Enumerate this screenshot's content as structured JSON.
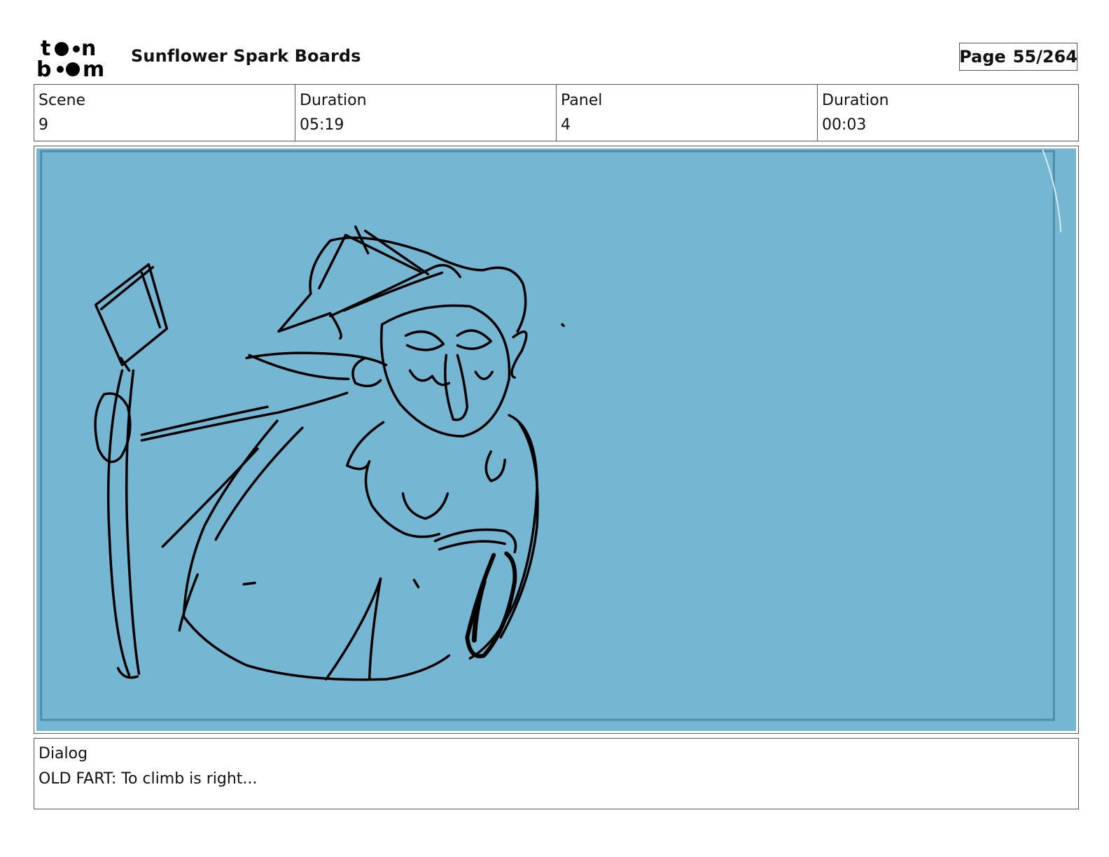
{
  "header": {
    "logo_text": "toon boom",
    "title": "Sunflower Spark Boards",
    "page_label": "Page",
    "page_value": "55/264"
  },
  "info": {
    "scene_label": "Scene",
    "scene_value": "9",
    "scene_duration_label": "Duration",
    "scene_duration_value": "05:19",
    "panel_label": "Panel",
    "panel_value": "4",
    "panel_duration_label": "Duration",
    "panel_duration_value": "00:03"
  },
  "panel": {
    "background_color": "#75b6d3",
    "drawing": "sketch-of-bearded-character-with-hat-and-staff"
  },
  "dialog": {
    "label": "Dialog",
    "text": "OLD FART: To climb is right..."
  }
}
